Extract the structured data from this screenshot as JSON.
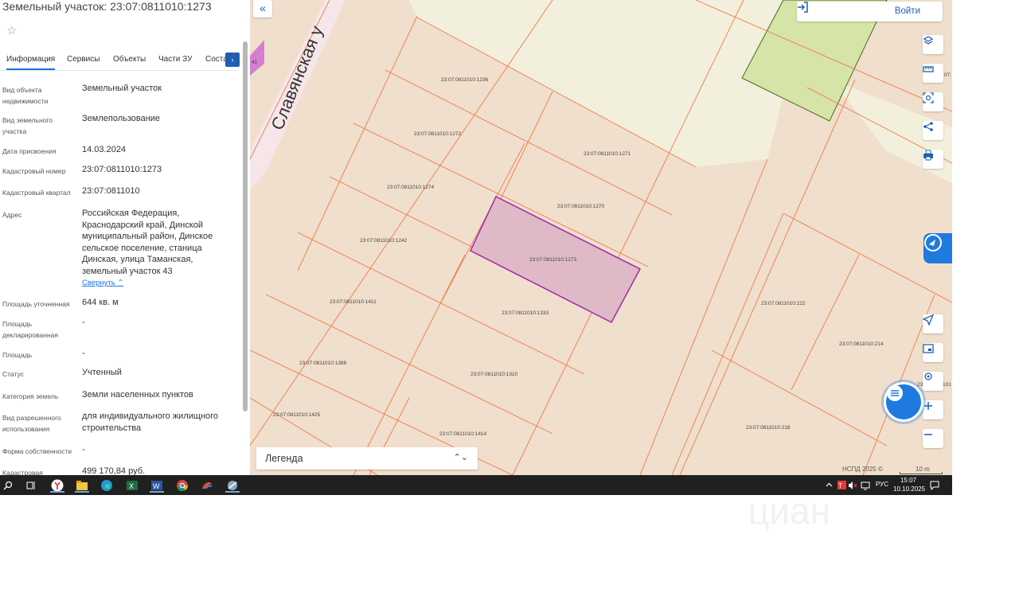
{
  "panel": {
    "title": "Земельный участок: 23:07:0811010:1273",
    "tabs": [
      "Информация",
      "Сервисы",
      "Объекты",
      "Части ЗУ",
      "Соста"
    ],
    "tab_next_label": "›",
    "rows": [
      {
        "label": "Вид объекта недвижимости",
        "value": "Земельный участок"
      },
      {
        "label": "Вид земельного участка",
        "value": "Землепользование"
      },
      {
        "label": "Дата присвоения",
        "value": "14.03.2024"
      },
      {
        "label": "Кадастровый номер",
        "value": "23:07:0811010:1273"
      },
      {
        "label": "Кадастровый квартал",
        "value": "23:07:0811010"
      },
      {
        "label": "Адрес",
        "value": "Российская Федерация, Краснодарский край, Динской муниципальный район, Динское сельское поселение, станица Динская, улица Таманская, земельный участок 43"
      },
      {
        "label": "Площадь уточненная",
        "value": "644 кв. м"
      },
      {
        "label": "Площадь декларированная",
        "value": "-"
      },
      {
        "label": "Площадь",
        "value": "-"
      },
      {
        "label": "Статус",
        "value": "Учтенный"
      },
      {
        "label": "Категория земель",
        "value": "Земли населенных пунктов"
      },
      {
        "label": "Вид разрешенного использования",
        "value": "для индивидуального жилищного строительства"
      },
      {
        "label": "Форма собственности",
        "value": "-"
      },
      {
        "label": "Кадастровая",
        "value": "499 170,84 руб."
      }
    ],
    "collapse_label": "Свернуть"
  },
  "map": {
    "street_name": "Славянская у",
    "login_label": "Войти",
    "legend_label": "Легенда",
    "attribution": "НСПД 2025 ©",
    "scale": "10 m",
    "plots": [
      {
        "id": "23:07:0811010:1236",
        "highlighted": false
      },
      {
        "id": "23:07:0811010:1272",
        "highlighted": false
      },
      {
        "id": "23:07:0811010:1271",
        "highlighted": false
      },
      {
        "id": "23:07:0811010:1274",
        "highlighted": false
      },
      {
        "id": "23:07:0811010:1270",
        "highlighted": false
      },
      {
        "id": "23:07:0811010:1242",
        "highlighted": false
      },
      {
        "id": "23:07:0811010:1273",
        "highlighted": true
      },
      {
        "id": "23:07:0811010:1411",
        "highlighted": false
      },
      {
        "id": "23:07:0811010:1333",
        "highlighted": false
      },
      {
        "id": "23:07:0811010:222",
        "highlighted": false
      },
      {
        "id": "23:07:0811010:214",
        "highlighted": false
      },
      {
        "id": "23:07:0811010:1388",
        "highlighted": false
      },
      {
        "id": "23:07:0811010:1310",
        "highlighted": false
      },
      {
        "id": "23:07:0811010:1425",
        "highlighted": false
      },
      {
        "id": "23:07:0811010:1414",
        "highlighted": false
      },
      {
        "id": "23:07:0811010:218",
        "highlighted": false
      }
    ],
    "edge_labels": [
      "41",
      "07:",
      "23",
      "101"
    ],
    "colors": {
      "parcel_fill": "#f0dfcc",
      "parcel_border": "#f07a4a",
      "selected_fill": "#dfbac6",
      "selected_border": "#9c2ab0",
      "green_area": "#d6e4a8",
      "light_area": "#f2f0dc",
      "accent": "#1f7ae0"
    }
  },
  "taskbar": {
    "apps": [
      "search-icon",
      "task-view-icon",
      "yandex-browser-icon",
      "file-explorer-icon",
      "edge-icon",
      "excel-icon",
      "word-icon",
      "chrome-icon",
      "app-icon",
      "app2-icon"
    ],
    "language": "РУС",
    "time": "15:07",
    "date": "10.10.2025"
  },
  "watermark": "циан"
}
